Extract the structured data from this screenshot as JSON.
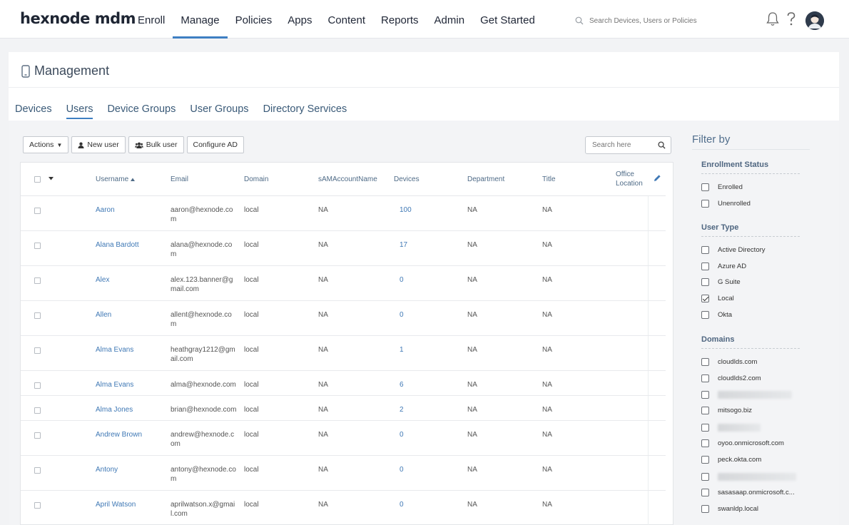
{
  "app": {
    "logo": "hexnode mdm"
  },
  "nav": [
    {
      "label": "Enroll",
      "active": false
    },
    {
      "label": "Manage",
      "active": true
    },
    {
      "label": "Policies",
      "active": false
    },
    {
      "label": "Apps",
      "active": false
    },
    {
      "label": "Content",
      "active": false
    },
    {
      "label": "Reports",
      "active": false
    },
    {
      "label": "Admin",
      "active": false
    },
    {
      "label": "Get Started",
      "active": false
    }
  ],
  "search": {
    "placeholder": "Search Devices, Users or Policies"
  },
  "header_icons": [
    "bell-icon",
    "help-icon",
    "user-avatar"
  ],
  "page": {
    "title": "Management",
    "icon": "mobile-device-icon"
  },
  "tabs": [
    {
      "label": "Devices",
      "active": false
    },
    {
      "label": "Users",
      "active": true
    },
    {
      "label": "Device Groups",
      "active": false
    },
    {
      "label": "User Groups",
      "active": false
    },
    {
      "label": "Directory Services",
      "active": false
    }
  ],
  "toolbar": {
    "actions_label": "Actions",
    "new_user_label": "New user",
    "bulk_user_label": "Bulk user",
    "configure_ad_label": "Configure AD",
    "table_search_placeholder": "Search here"
  },
  "table": {
    "columns": [
      "Username",
      "Email",
      "Domain",
      "sAMAccountName",
      "Devices",
      "Department",
      "Title",
      "Office Location"
    ],
    "sort_column": "Username",
    "sort_direction": "ascending",
    "rows": [
      {
        "username": "Aaron",
        "email": [
          "aaron@hexnode.co",
          "m"
        ],
        "domain": "local",
        "sam": "NA",
        "devices": "100",
        "department": "NA",
        "title": "NA"
      },
      {
        "username": "Alana Bardott",
        "email": [
          "alana@hexnode.co",
          "m"
        ],
        "domain": "local",
        "sam": "NA",
        "devices": "17",
        "department": "NA",
        "title": "NA"
      },
      {
        "username": "Alex",
        "email": [
          "alex.123.banner@g",
          "mail.com"
        ],
        "domain": "local",
        "sam": "NA",
        "devices": "0",
        "department": "NA",
        "title": "NA"
      },
      {
        "username": "Allen",
        "email": [
          "allent@hexnode.co",
          "m"
        ],
        "domain": "local",
        "sam": "NA",
        "devices": "0",
        "department": "NA",
        "title": "NA"
      },
      {
        "username": "Alma Evans",
        "email": [
          "heathgray1212@gm",
          "ail.com"
        ],
        "domain": "local",
        "sam": "NA",
        "devices": "1",
        "department": "NA",
        "title": "NA"
      },
      {
        "username": "Alma Evans",
        "email": [
          "alma@hexnode.com"
        ],
        "domain": "local",
        "sam": "NA",
        "devices": "6",
        "department": "NA",
        "title": "NA"
      },
      {
        "username": "Alma Jones",
        "email": [
          "brian@hexnode.com"
        ],
        "domain": "local",
        "sam": "NA",
        "devices": "2",
        "department": "NA",
        "title": "NA"
      },
      {
        "username": "Andrew Brown",
        "email": [
          "andrew@hexnode.c",
          "om"
        ],
        "domain": "local",
        "sam": "NA",
        "devices": "0",
        "department": "NA",
        "title": "NA"
      },
      {
        "username": "Antony",
        "email": [
          "antony@hexnode.co",
          "m"
        ],
        "domain": "local",
        "sam": "NA",
        "devices": "0",
        "department": "NA",
        "title": "NA"
      },
      {
        "username": "April Watson",
        "email": [
          "aprilwatson.x@gmai",
          "l.com"
        ],
        "domain": "local",
        "sam": "NA",
        "devices": "0",
        "department": "NA",
        "title": "NA"
      }
    ]
  },
  "filter": {
    "title": "Filter by",
    "sections": [
      {
        "title": "Enrollment Status",
        "items": [
          {
            "label": "Enrolled",
            "checked": false
          },
          {
            "label": "Unenrolled",
            "checked": false
          }
        ]
      },
      {
        "title": "User Type",
        "items": [
          {
            "label": "Active Directory",
            "checked": false
          },
          {
            "label": "Azure AD",
            "checked": false
          },
          {
            "label": "G Suite",
            "checked": false
          },
          {
            "label": "Local",
            "checked": true
          },
          {
            "label": "Okta",
            "checked": false
          }
        ]
      },
      {
        "title": "Domains",
        "items": [
          {
            "label": "cloudlds.com",
            "checked": false
          },
          {
            "label": "cloudlds2.com",
            "checked": false
          },
          {
            "label": "",
            "checked": false,
            "redacted": true
          },
          {
            "label": "mitsogo.biz",
            "checked": false
          },
          {
            "label": "",
            "checked": false,
            "redacted": true
          },
          {
            "label": "oyoo.onmicrosoft.com",
            "checked": false
          },
          {
            "label": "peck.okta.com",
            "checked": false
          },
          {
            "label": "",
            "checked": false,
            "redacted": true
          },
          {
            "label": "sasasaap.onmicrosoft.c...",
            "checked": false
          },
          {
            "label": "swanldp.local",
            "checked": false
          }
        ]
      }
    ]
  }
}
